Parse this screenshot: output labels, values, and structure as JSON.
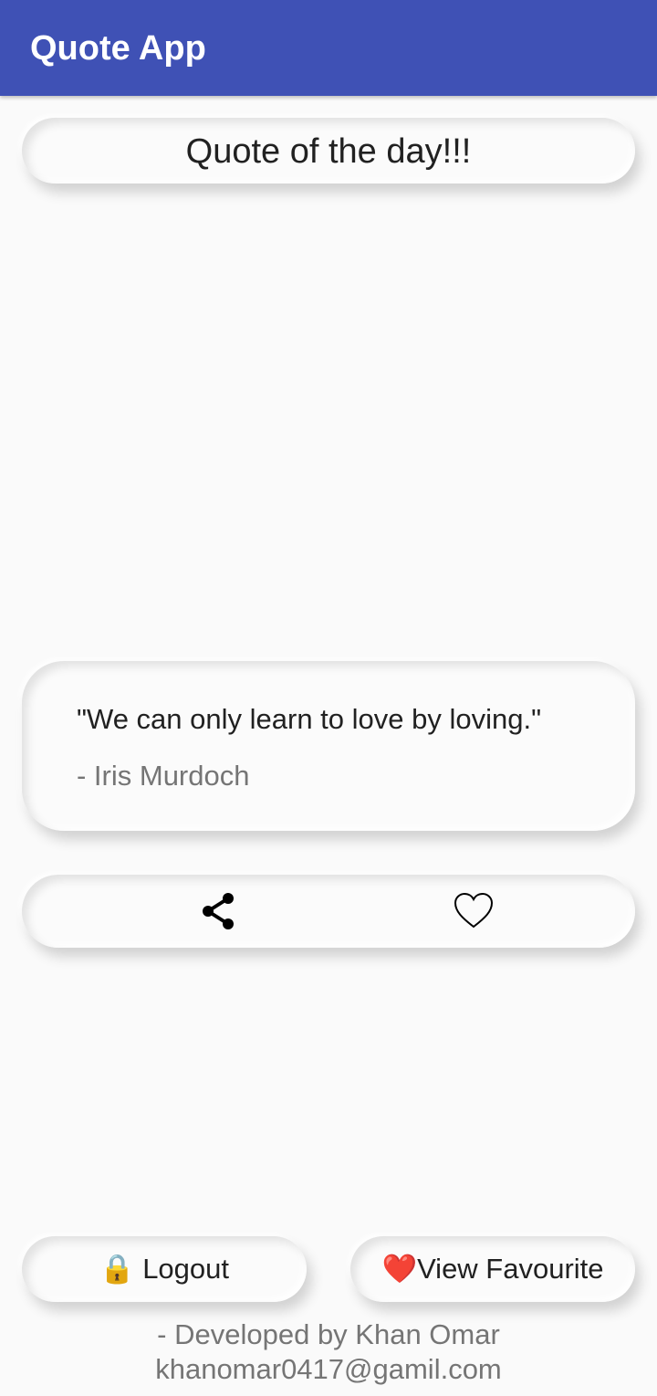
{
  "app_bar": {
    "title": "Quote App",
    "color": "#3f51b5"
  },
  "header": {
    "label": "Quote of the day!!!"
  },
  "quote": {
    "text": "\"We can only learn to love by loving.\"",
    "author": "- Iris Murdoch"
  },
  "actions": {
    "share_icon": "share-icon",
    "favourite_icon": "heart-outline-icon"
  },
  "buttons": {
    "logout": {
      "emoji": "🔒",
      "label": " Logout"
    },
    "view_favourite": {
      "emoji": "❤️",
      "label": "View Favourite"
    }
  },
  "footer": {
    "developer": "- Developed by Khan Omar",
    "email": "khanomar0417@gamil.com"
  }
}
